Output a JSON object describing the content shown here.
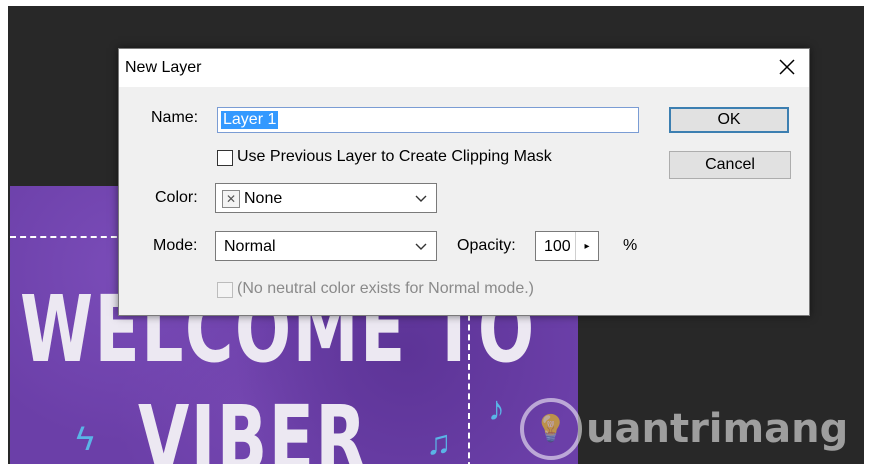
{
  "dialog": {
    "title": "New Layer",
    "name_label": "Name:",
    "name_value": "Layer 1",
    "ok_label": "OK",
    "cancel_label": "Cancel",
    "clipping_mask_label": "Use Previous Layer to Create Clipping Mask",
    "clipping_mask_checked": false,
    "color_label": "Color:",
    "color_value": "None",
    "mode_label": "Mode:",
    "mode_value": "Normal",
    "opacity_label": "Opacity:",
    "opacity_value": "100",
    "opacity_unit": "%",
    "neutral_color_label": "(No neutral color exists for Normal mode.)",
    "neutral_color_enabled": false
  },
  "canvas": {
    "line1": "WELCOME TO",
    "line2": "VIBER"
  },
  "watermark": {
    "text": "uantrimang"
  },
  "colors": {
    "workspace": "#282828",
    "artwork": "#6b3fa8",
    "selection_highlight": "#3399ff",
    "default_button_border": "#3c7fb1"
  },
  "icons": [
    "close-icon",
    "chevron-down-icon",
    "no-color-icon",
    "arrow-right-icon",
    "lightbulb-icon"
  ]
}
